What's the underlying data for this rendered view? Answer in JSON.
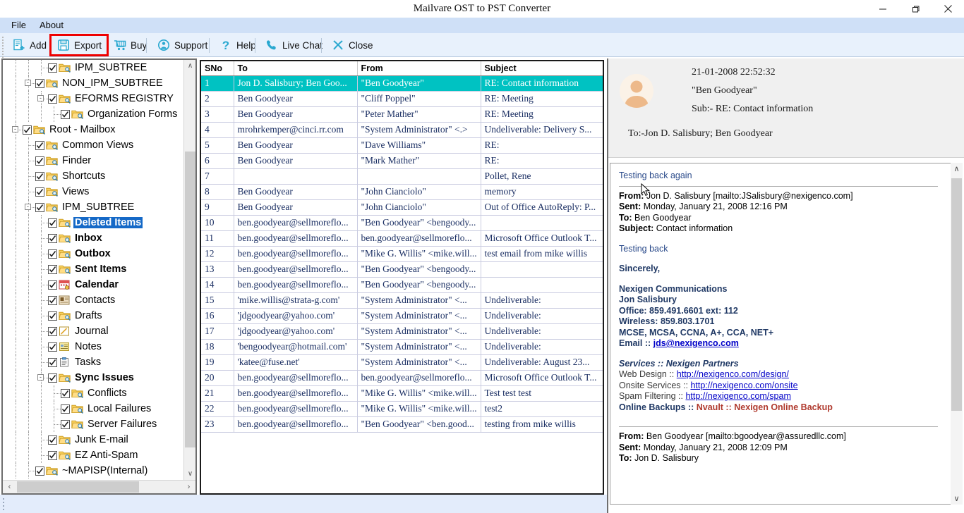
{
  "window": {
    "title": "Mailvare OST to PST Converter",
    "minimize_label": "–",
    "maximize_label": "❐",
    "close_label": "✕"
  },
  "menubar": {
    "items": [
      {
        "label": "File"
      },
      {
        "label": "About"
      }
    ]
  },
  "toolbar": {
    "highlight_color": "#ee0000",
    "accent_color": "#29a8d0",
    "buttons": [
      {
        "label": "Add",
        "icon": "add-document-icon"
      },
      {
        "label": "Export",
        "icon": "floppy-save-icon"
      },
      {
        "label": "Buy",
        "icon": "shopping-cart-icon"
      },
      {
        "label": "Support",
        "icon": "person-circle-icon"
      },
      {
        "label": "Help",
        "icon": "question-mark-icon"
      },
      {
        "label": "Live Chat",
        "icon": "phone-icon"
      },
      {
        "label": "Close",
        "icon": "x-cross-icon"
      }
    ]
  },
  "tree": {
    "selected_label": "Deleted Items",
    "selection_color": "#1569c7",
    "nodes": [
      {
        "label": "IPM_SUBTREE",
        "indent": 2,
        "icon": "folder-search-icon",
        "expander": "",
        "bold": false,
        "selected": false
      },
      {
        "label": "NON_IPM_SUBTREE",
        "indent": 1,
        "icon": "folder-search-icon",
        "expander": "-",
        "bold": false,
        "selected": false
      },
      {
        "label": "EFORMS REGISTRY",
        "indent": 2,
        "icon": "folder-search-icon",
        "expander": "-",
        "bold": false,
        "selected": false
      },
      {
        "label": "Organization Forms",
        "indent": 3,
        "icon": "folder-search-icon",
        "expander": "",
        "bold": false,
        "selected": false
      },
      {
        "label": "Root - Mailbox",
        "indent": 0,
        "icon": "folder-search-icon",
        "expander": "-",
        "bold": false,
        "selected": false
      },
      {
        "label": "Common Views",
        "indent": 1,
        "icon": "folder-search-icon",
        "expander": "",
        "bold": false,
        "selected": false
      },
      {
        "label": "Finder",
        "indent": 1,
        "icon": "folder-search-icon",
        "expander": "",
        "bold": false,
        "selected": false
      },
      {
        "label": "Shortcuts",
        "indent": 1,
        "icon": "folder-search-icon",
        "expander": "",
        "bold": false,
        "selected": false
      },
      {
        "label": "Views",
        "indent": 1,
        "icon": "folder-search-icon",
        "expander": "",
        "bold": false,
        "selected": false
      },
      {
        "label": "IPM_SUBTREE",
        "indent": 1,
        "icon": "folder-search-icon",
        "expander": "-",
        "bold": false,
        "selected": false
      },
      {
        "label": "Deleted Items",
        "indent": 2,
        "icon": "folder-search-icon",
        "expander": "",
        "bold": true,
        "selected": true
      },
      {
        "label": "Inbox",
        "indent": 2,
        "icon": "folder-search-icon",
        "expander": "",
        "bold": true,
        "selected": false
      },
      {
        "label": "Outbox",
        "indent": 2,
        "icon": "folder-search-icon",
        "expander": "",
        "bold": true,
        "selected": false
      },
      {
        "label": "Sent Items",
        "indent": 2,
        "icon": "folder-search-icon",
        "expander": "",
        "bold": true,
        "selected": false
      },
      {
        "label": "Calendar",
        "indent": 2,
        "icon": "calendar-icon",
        "expander": "",
        "bold": true,
        "selected": false
      },
      {
        "label": "Contacts",
        "indent": 2,
        "icon": "contacts-card-icon",
        "expander": "",
        "bold": false,
        "selected": false
      },
      {
        "label": "Drafts",
        "indent": 2,
        "icon": "folder-search-icon",
        "expander": "",
        "bold": false,
        "selected": false
      },
      {
        "label": "Journal",
        "indent": 2,
        "icon": "journal-pencil-icon",
        "expander": "",
        "bold": false,
        "selected": false
      },
      {
        "label": "Notes",
        "indent": 2,
        "icon": "notes-icon",
        "expander": "",
        "bold": false,
        "selected": false
      },
      {
        "label": "Tasks",
        "indent": 2,
        "icon": "tasks-clipboard-icon",
        "expander": "",
        "bold": false,
        "selected": false
      },
      {
        "label": "Sync Issues",
        "indent": 2,
        "icon": "folder-search-icon",
        "expander": "-",
        "bold": true,
        "selected": false
      },
      {
        "label": "Conflicts",
        "indent": 3,
        "icon": "folder-search-icon",
        "expander": "",
        "bold": false,
        "selected": false
      },
      {
        "label": "Local Failures",
        "indent": 3,
        "icon": "folder-search-icon",
        "expander": "",
        "bold": false,
        "selected": false
      },
      {
        "label": "Server Failures",
        "indent": 3,
        "icon": "folder-search-icon",
        "expander": "",
        "bold": false,
        "selected": false
      },
      {
        "label": "Junk E-mail",
        "indent": 2,
        "icon": "folder-search-icon",
        "expander": "",
        "bold": false,
        "selected": false
      },
      {
        "label": "EZ Anti-Spam",
        "indent": 2,
        "icon": "folder-search-icon",
        "expander": "",
        "bold": false,
        "selected": false
      },
      {
        "label": "~MAPISP(Internal)",
        "indent": 1,
        "icon": "folder-search-icon",
        "expander": "",
        "bold": false,
        "selected": false
      }
    ]
  },
  "grid": {
    "selected_row_color": "#00c2c2",
    "columns": [
      "SNo",
      "To",
      "From",
      "Subject"
    ],
    "rows": [
      {
        "sno": "1",
        "to": "Jon D. Salisbury; Ben Goo...",
        "from": "\"Ben Goodyear\"",
        "subject": "RE: Contact information",
        "selected": true
      },
      {
        "sno": "2",
        "to": "Ben Goodyear",
        "from": "\"Cliff Poppel\"",
        "subject": "RE: Meeting",
        "selected": false
      },
      {
        "sno": "3",
        "to": "Ben Goodyear",
        "from": "\"Peter Mather\"",
        "subject": "RE: Meeting",
        "selected": false
      },
      {
        "sno": "4",
        "to": "mrohrkemper@cinci.rr.com",
        "from": "\"System Administrator\" <.>",
        "subject": "Undeliverable: Delivery S...",
        "selected": false
      },
      {
        "sno": "5",
        "to": "Ben Goodyear",
        "from": "\"Dave Williams\"",
        "subject": "RE:",
        "selected": false
      },
      {
        "sno": "6",
        "to": "Ben Goodyear",
        "from": "\"Mark Mather\"",
        "subject": "RE:",
        "selected": false
      },
      {
        "sno": "7",
        "to": "",
        "from": "",
        "subject": "Pollet, Rene",
        "selected": false
      },
      {
        "sno": "8",
        "to": "Ben Goodyear",
        "from": "\"John Cianciolo\"",
        "subject": "memory",
        "selected": false
      },
      {
        "sno": "9",
        "to": "Ben Goodyear",
        "from": "\"John Cianciolo\"",
        "subject": "Out of Office AutoReply: P...",
        "selected": false
      },
      {
        "sno": "10",
        "to": "ben.goodyear@sellmoreflo...",
        "from": "\"Ben Goodyear\" <bengoody...",
        "subject": "",
        "selected": false
      },
      {
        "sno": "11",
        "to": "ben.goodyear@sellmoreflo...",
        "from": "ben.goodyear@sellmoreflo...",
        "subject": "Microsoft Office Outlook T...",
        "selected": false
      },
      {
        "sno": "12",
        "to": "ben.goodyear@sellmoreflo...",
        "from": "\"Mike G. Willis\" <mike.will...",
        "subject": "test email from mike willis",
        "selected": false
      },
      {
        "sno": "13",
        "to": "ben.goodyear@sellmoreflo...",
        "from": "\"Ben Goodyear\" <bengoody...",
        "subject": "",
        "selected": false
      },
      {
        "sno": "14",
        "to": "ben.goodyear@sellmoreflo...",
        "from": "\"Ben Goodyear\" <bengoody...",
        "subject": "",
        "selected": false
      },
      {
        "sno": "15",
        "to": "'mike.willis@strata-g.com'",
        "from": "\"System Administrator\" <...",
        "subject": "Undeliverable:",
        "selected": false
      },
      {
        "sno": "16",
        "to": "'jdgoodyear@yahoo.com'",
        "from": "\"System Administrator\" <...",
        "subject": "Undeliverable:",
        "selected": false
      },
      {
        "sno": "17",
        "to": "'jdgoodyear@yahoo.com'",
        "from": "\"System Administrator\" <...",
        "subject": "Undeliverable:",
        "selected": false
      },
      {
        "sno": "18",
        "to": "'bengoodyear@hotmail.com'",
        "from": "\"System Administrator\" <...",
        "subject": "Undeliverable:",
        "selected": false
      },
      {
        "sno": "19",
        "to": "'katee@fuse.net'",
        "from": "\"System Administrator\" <...",
        "subject": "Undeliverable: August 23...",
        "selected": false
      },
      {
        "sno": "20",
        "to": "ben.goodyear@sellmoreflo...",
        "from": "ben.goodyear@sellmoreflo...",
        "subject": "Microsoft Office Outlook T...",
        "selected": false
      },
      {
        "sno": "21",
        "to": "ben.goodyear@sellmoreflo...",
        "from": "\"Mike G. Willis\" <mike.will...",
        "subject": "Test test test",
        "selected": false
      },
      {
        "sno": "22",
        "to": "ben.goodyear@sellmoreflo...",
        "from": "\"Mike G. Willis\" <mike.will...",
        "subject": "test2",
        "selected": false
      },
      {
        "sno": "23",
        "to": "ben.goodyear@sellmoreflo...",
        "from": "\"Ben Goodyear\" <ben.good...",
        "subject": "testing from mike willis",
        "selected": false
      }
    ]
  },
  "preview": {
    "date": "21-01-2008 22:52:32",
    "from": "\"Ben Goodyear\"",
    "subject": "Sub:- RE: Contact information",
    "to": "To:-Jon D. Salisbury; Ben Goodyear",
    "body": {
      "intro": "Testing back again",
      "msg1": {
        "from_label": "From:",
        "from_value": " Jon D. Salisbury [mailto:JSalisbury@nexigenco.com]",
        "sent_label": "Sent:",
        "sent_value": " Monday, January 21, 2008 12:16 PM",
        "to_label": "To:",
        "to_value": " Ben Goodyear",
        "subject_label": "Subject:",
        "subject_value": " Contact information"
      },
      "testing_back": "Testing back",
      "sincerely": "Sincerely,",
      "signature": {
        "company": "Nexigen Communications",
        "name": "Jon Salisbury",
        "office": "Office: 859.491.6601 ext: 112",
        "wireless": "Wireless: 859.803.1701",
        "certs": "MCSE, MCSA, CCNA, A+, CCA, NET+",
        "email_label": "Email :: ",
        "email_value": "jds@nexigenco.com"
      },
      "services": {
        "heading": "Services :: Nexigen Partners",
        "items": [
          {
            "label": "Web Design :: ",
            "link": "http://nexigenco.com/design/"
          },
          {
            "label": "Onsite Services :: ",
            "link": "http://nexigenco.com/onsite"
          },
          {
            "label": "Spam Filtering :: ",
            "link": "http://nexigenco.com/spam"
          }
        ],
        "backup_label": "Online Backups :: ",
        "backup_value": "Nvault :: Nexigen Online Backup"
      },
      "msg2": {
        "from_label": "From:",
        "from_value": " Ben Goodyear [mailto:bgoodyear@assuredllc.com]",
        "sent_label": "Sent:",
        "sent_value": " Monday, January 21, 2008 12:09 PM",
        "to_label": "To:",
        "to_value": " Jon D. Salisbury"
      }
    }
  },
  "scrollbars": {
    "tree_up": "∧",
    "tree_down": "∨",
    "tree_left": "‹",
    "tree_right": "›",
    "prev_up": "∧",
    "prev_down": "∨"
  }
}
